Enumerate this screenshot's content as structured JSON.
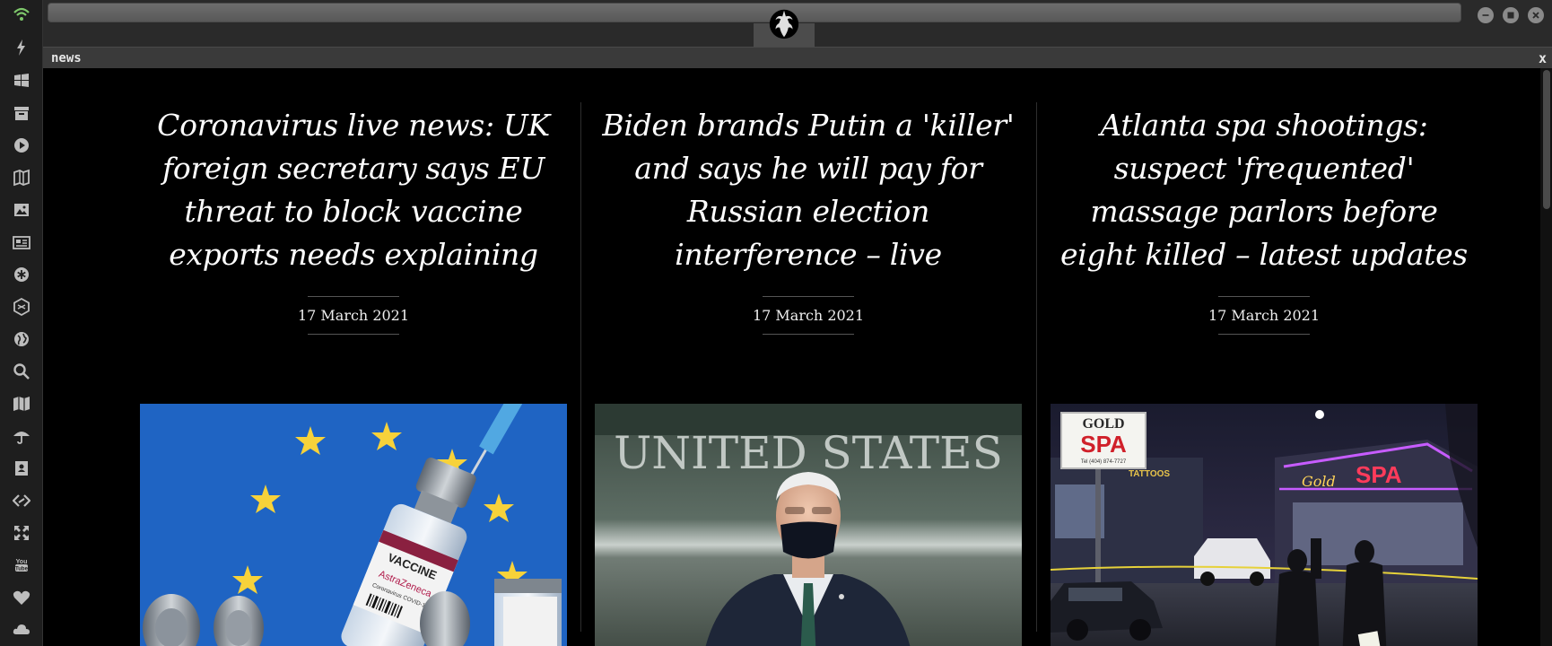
{
  "dock": {
    "items": [
      {
        "name": "wifi-icon"
      },
      {
        "name": "lightning-icon"
      },
      {
        "name": "windows-icon"
      },
      {
        "name": "archive-icon"
      },
      {
        "name": "play-icon"
      },
      {
        "name": "map-book-icon"
      },
      {
        "name": "image-icon"
      },
      {
        "name": "newspaper-icon"
      },
      {
        "name": "asterisk-circle-icon"
      },
      {
        "name": "hexagon-icon"
      },
      {
        "name": "globe-icon"
      },
      {
        "name": "search-icon"
      },
      {
        "name": "map-icon"
      },
      {
        "name": "umbrella-icon"
      },
      {
        "name": "contacts-icon"
      },
      {
        "name": "code-icon"
      },
      {
        "name": "expand-icon"
      },
      {
        "name": "youtube-icon"
      },
      {
        "name": "heart-icon"
      },
      {
        "name": "cloud-icon"
      }
    ],
    "active_color": "#7ec86b",
    "icon_color": "#bdbdbd"
  },
  "window": {
    "logo_icon": "rebel-alliance-icon",
    "buttons": [
      "minimize-icon",
      "maximize-icon",
      "close-icon"
    ]
  },
  "pane": {
    "title": "news",
    "close_label": "x"
  },
  "articles": [
    {
      "headline": "Coronavirus live news: UK foreign secretary says EU threat to block vaccine exports needs explaining",
      "date": "17 March 2021",
      "image": "vaccine-vials-eu-flag"
    },
    {
      "headline": "Biden brands Putin a 'killer' and says he will pay for Russian election interference – live",
      "date": "17 March 2021",
      "image": "biden-united-states-aircraft"
    },
    {
      "headline": "Atlanta spa shootings: suspect 'frequented' massage parlors before eight killed – latest updates",
      "date": "17 March 2021",
      "image": "gold-spa-night-police"
    }
  ],
  "photo_text": {
    "vaccine_label": "VACCINE",
    "vaccine_brand": "AstraZeneca",
    "vaccine_sub": "Coronavirus COVID-19",
    "building_text": "UNITED STATES",
    "spa_sign_top": "GOLD",
    "spa_sign_main": "SPA",
    "spa_sign_phone": "Tel (404) 874-7727",
    "spa_tattoos": "TATTOOS",
    "spa_neon_gold": "Gold",
    "spa_neon_spa": "SPA"
  }
}
